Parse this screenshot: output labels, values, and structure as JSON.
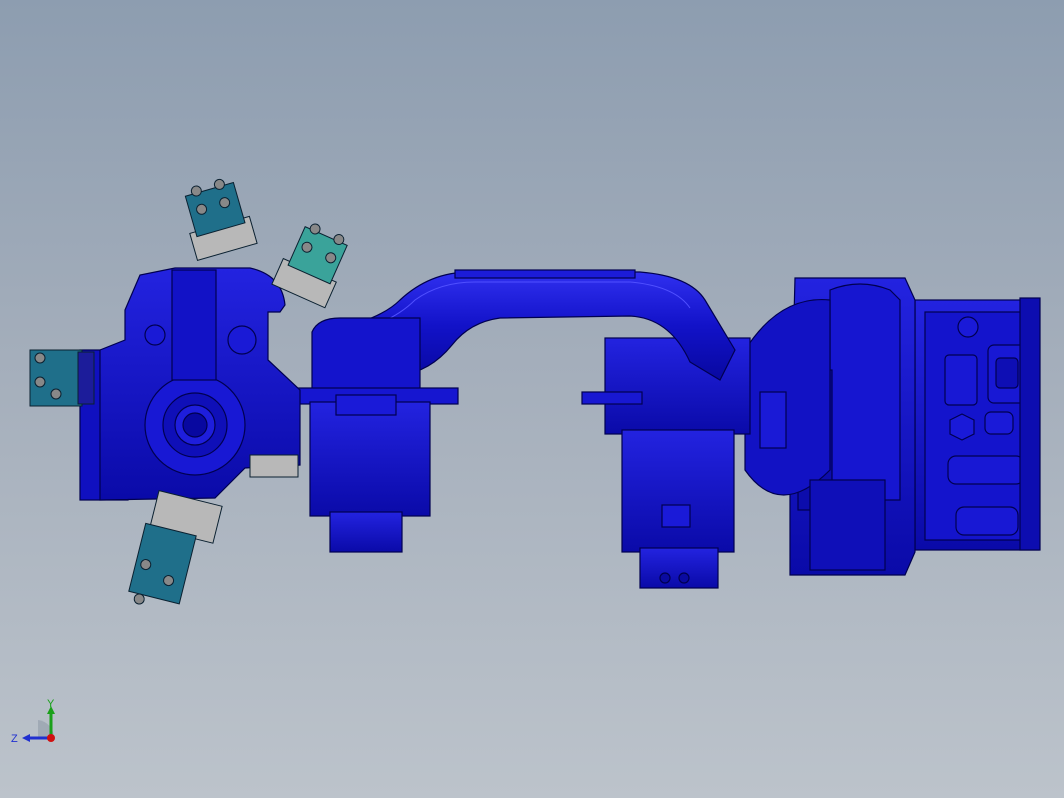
{
  "scene": {
    "background_top": "#8d9db0",
    "background_bottom": "#bcc3cb",
    "part_color": "#1010c8",
    "part_edge": "#000050",
    "gripper_color": "#1f6f8a",
    "gripper_accent": "#3aa39a",
    "plate_color": "#b8b8b8"
  },
  "triad": {
    "y_label": "Y",
    "z_label": "Z",
    "y_color": "#1aa01a",
    "z_color": "#2030d0",
    "x_color": "#d01010"
  }
}
